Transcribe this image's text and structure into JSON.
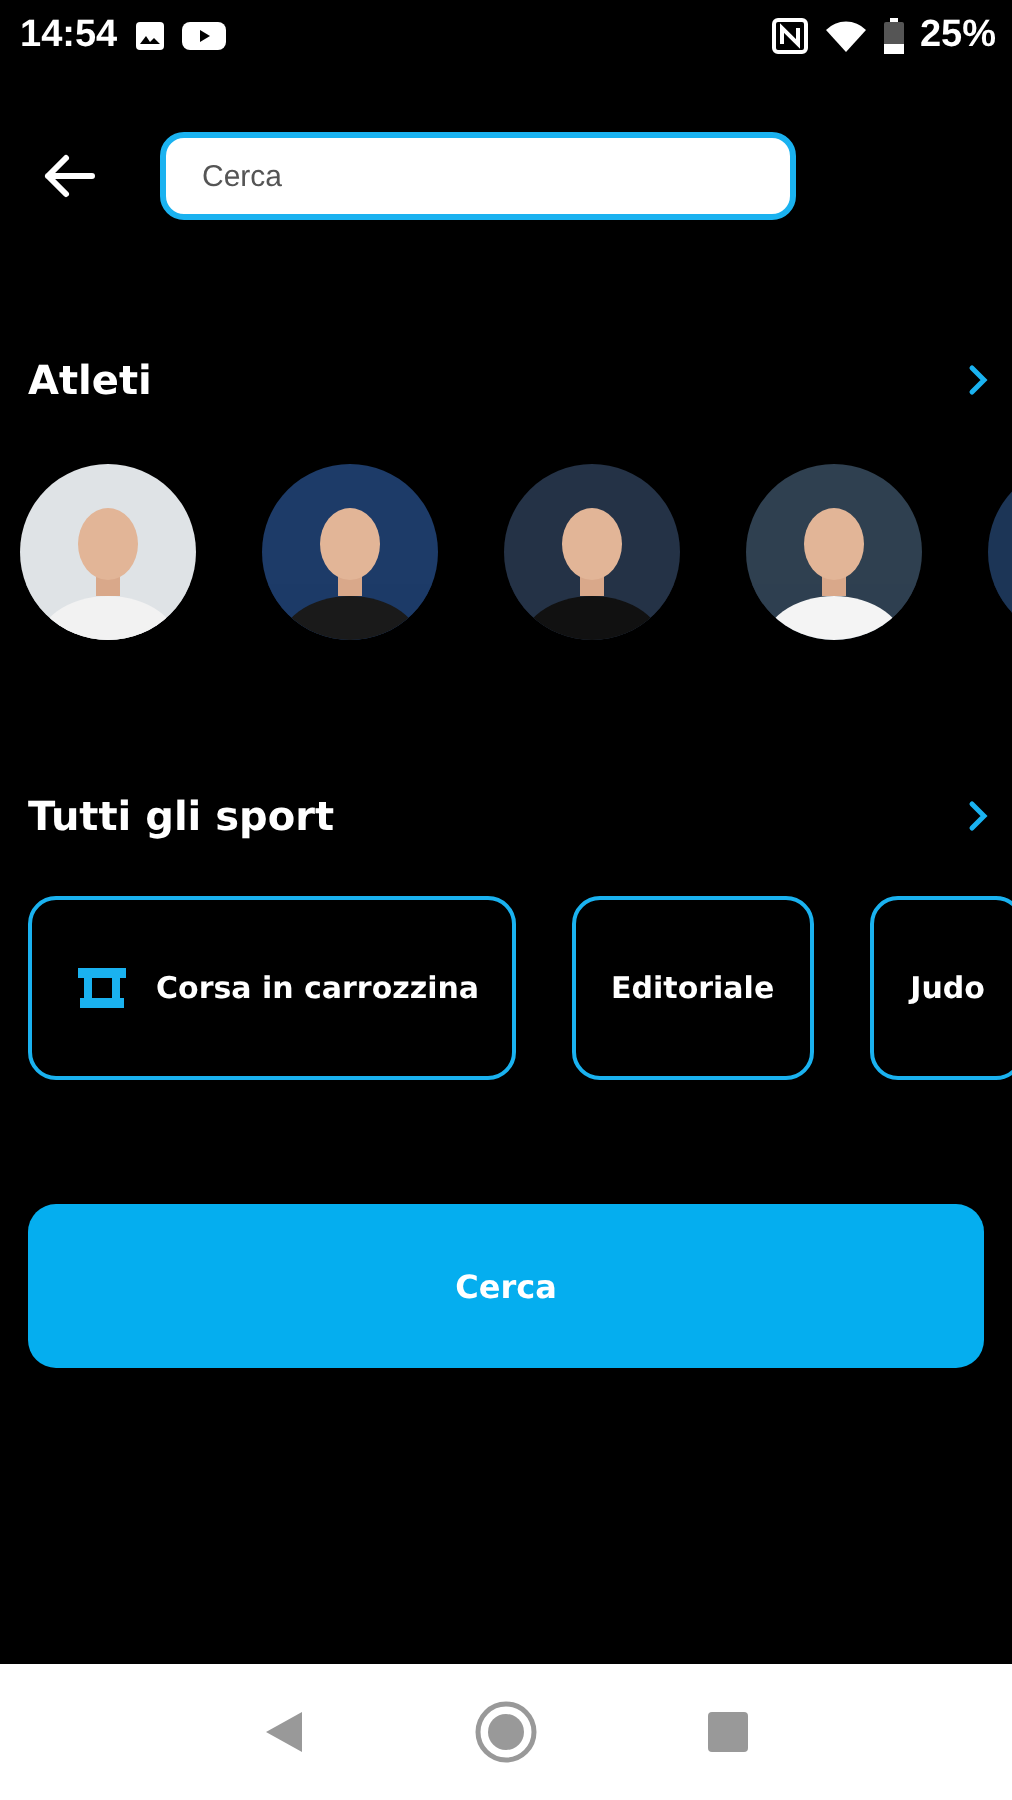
{
  "status_bar": {
    "time": "14:54",
    "battery": "25%"
  },
  "search": {
    "placeholder": "Cerca"
  },
  "athletes": {
    "title": "Atleti"
  },
  "sports": {
    "title": "Tutti gli sport",
    "items": [
      {
        "label": "Corsa in carrozzina",
        "kind": "with_icon"
      },
      {
        "label": "Editoriale",
        "kind": "plain"
      },
      {
        "label": "Judo",
        "kind": "plain"
      }
    ]
  },
  "button": {
    "label": "Cerca"
  }
}
